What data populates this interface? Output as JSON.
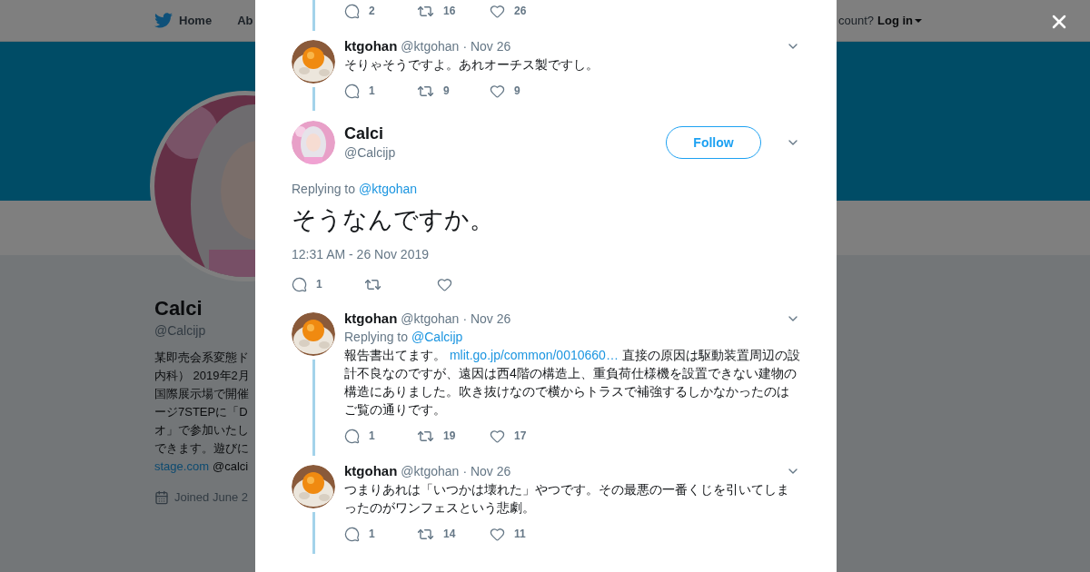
{
  "header": {
    "nav": [
      {
        "label": "Home"
      },
      {
        "label": "Ab"
      }
    ],
    "login_prompt": "count?",
    "login": "Log in"
  },
  "profile": {
    "name": "Calci",
    "handle": "@Calcijp",
    "bio_lines": [
      "某即売会系変態ド",
      "内科） 2019年2月",
      "国際展示場で開催",
      "ージ7STEPに「D",
      "オ」で参加いたし",
      "できます。遊びに"
    ],
    "link": "stage.com",
    "mention": "@calci",
    "joined": "Joined June 2"
  },
  "thread_top": {
    "replies": "2",
    "retweets": "16",
    "likes": "26"
  },
  "before": [
    {
      "name": "ktgohan",
      "handle": "@ktgohan",
      "date": "· Nov 26",
      "text": "そりゃそうですよ。あれオーチス製ですし。",
      "replies": "1",
      "retweets": "9",
      "likes": "9"
    }
  ],
  "main": {
    "name": "Calci",
    "handle": "@Calcijp",
    "follow": "Follow",
    "replying_label": "Replying to",
    "replying_to": "@ktgohan",
    "text": "そうなんですか。",
    "time": "12:31 AM - 26 Nov 2019",
    "replies": "1"
  },
  "after": [
    {
      "name": "ktgohan",
      "handle": "@ktgohan",
      "date": "· Nov 26",
      "replying_label": "Replying to",
      "replying_to": "@Calcijp",
      "text": "報告書出てます。 ",
      "link": "mlit.go.jp/common/0010660…",
      "text_after": " 直接の原因は駆動装置周辺の設計不良なのですが、遠因は西4階の構造上、重負荷仕様機を設置できない建物の構造にありました。吹き抜けなので横からトラスで補強するしかなかったのはご覧の通りです。",
      "replies": "1",
      "retweets": "19",
      "likes": "17"
    },
    {
      "name": "ktgohan",
      "handle": "@ktgohan",
      "date": "· Nov 26",
      "text": "つまりあれは「いつかは壊れた」やつです。その最悪の一番くじを引いてしまったのがワンフェスという悲劇。",
      "replies": "1",
      "retweets": "14",
      "likes": "11"
    }
  ]
}
